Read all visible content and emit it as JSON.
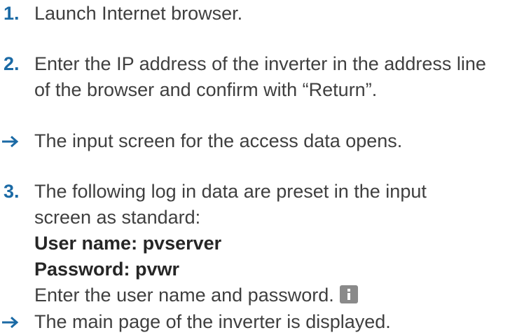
{
  "steps": [
    {
      "marker": "1.",
      "lines": [
        "Launch Internet browser."
      ]
    },
    {
      "marker": "2.",
      "lines": [
        "Enter the IP address of the inverter in the address line",
        "of the browser and confirm with “Return”."
      ]
    },
    {
      "result": "The input screen for the access data opens."
    },
    {
      "marker": "3.",
      "lines": [
        "The following log in data are preset in the input",
        "screen as standard:"
      ],
      "user_name": "User name: pvserver",
      "password": "Password: pvwr",
      "instruction": "Enter the user name and password."
    },
    {
      "result": "The main page of the inverter is displayed."
    }
  ],
  "icons": {
    "result_arrow": "right-arrow-icon",
    "info": "info-icon"
  },
  "colors": {
    "step_number": "#1b6aa5",
    "text": "#3f3f3f",
    "info_icon_bg": "#8a8a8a"
  }
}
